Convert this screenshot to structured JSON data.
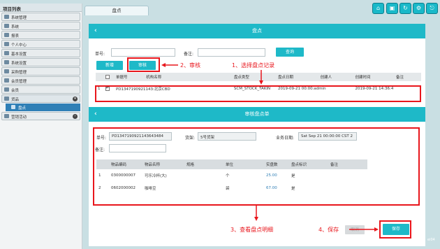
{
  "sidebar": {
    "title": "项目列表",
    "items": [
      {
        "label": "系统管理"
      },
      {
        "label": "系统"
      },
      {
        "label": "报表"
      },
      {
        "label": "个人中心"
      },
      {
        "label": "基本设置"
      },
      {
        "label": "系统设置"
      },
      {
        "label": "采购管理"
      },
      {
        "label": "会员管理"
      },
      {
        "label": "会员"
      },
      {
        "label": "盘点"
      },
      {
        "label": "营销活动"
      }
    ],
    "active_sub": "盘点"
  },
  "tab": {
    "label": "盘点"
  },
  "toolbar_icons": [
    "home-icon",
    "window-icon",
    "refresh-icon",
    "settings-icon",
    "exit-icon"
  ],
  "toolbar_glyphs": [
    "⌂",
    "▣",
    "↻",
    "⚙",
    "⎋"
  ],
  "top_panel": {
    "title": "盘点",
    "back": "‹",
    "form": {
      "order_label": "单号:",
      "remark_label": "备注:",
      "order_value": "",
      "remark_value": ""
    },
    "query_btn": "查询",
    "add_btn": "新增",
    "audit_btn": "审核",
    "columns": [
      "",
      "",
      "单据号",
      "机构名称",
      "盘点类型",
      "盘点日期",
      "创建人",
      "创建时间",
      "备注"
    ],
    "rows": [
      {
        "index": "1",
        "checked": true,
        "order": "PD1347190921143:",
        "org": "北京CBD",
        "type": "SCM_STOCK_TAKIN",
        "date": "2019-09-21 00:00:",
        "creator": "admin",
        "created": "2019-09-21 14:36:4",
        "remark": ""
      }
    ]
  },
  "detail_panel": {
    "title": "审核盘点单",
    "back": "‹",
    "order_label": "单号:",
    "order_value": "PD1347190921143643484",
    "loc_label": "货架:",
    "loc_value": "5号货架",
    "date_label": "业务日期:",
    "date_value": "Sat Sep 21 00:00:00 CST 2",
    "remark_label": "备注:",
    "remark_value": "",
    "columns": [
      "",
      "物品编码",
      "物品名称",
      "规格",
      "单位",
      "实盘数",
      "盘点标识",
      "备注"
    ],
    "rows": [
      {
        "index": "1",
        "code": "0300000007",
        "name": "可乐冷杯(大)",
        "spec": "",
        "unit": "个",
        "qty": "25.00",
        "flag": "是",
        "remark": ""
      },
      {
        "index": "2",
        "code": "0602000002",
        "name": "咖啡豆",
        "spec": "",
        "unit": "袋",
        "qty": "67.00",
        "flag": "是",
        "remark": ""
      }
    ],
    "cancel_btn": "取消",
    "save_btn": "保存"
  },
  "annotations": {
    "step1": "1、选择盘点记录",
    "step2": "2、审核",
    "step3": "3、查看盘点明细",
    "step4": "4、保存",
    "color": "#e8161c"
  },
  "corner_text": "ei04"
}
